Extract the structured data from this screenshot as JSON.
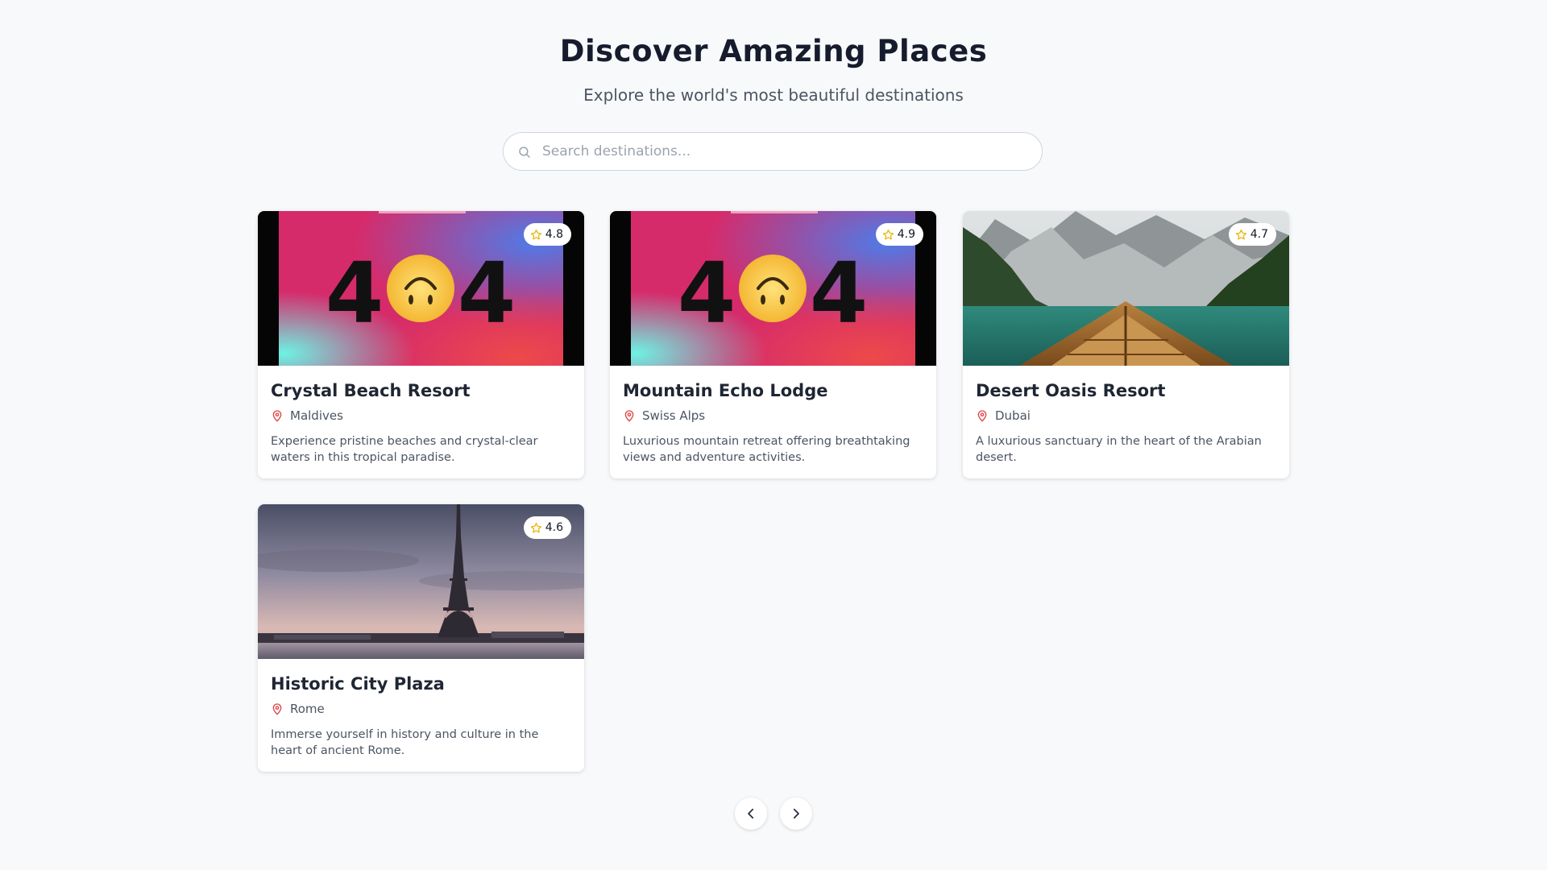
{
  "header": {
    "title": "Discover Amazing Places",
    "subtitle": "Explore the world's most beautiful destinations"
  },
  "search": {
    "placeholder": "Search destinations...",
    "value": "",
    "icon": "search-icon"
  },
  "colors": {
    "background": "#f8f9fb",
    "pin": "#e04444",
    "star": "#eab308",
    "title": "#161c2d"
  },
  "destinations": [
    {
      "name": "Crystal Beach Resort",
      "location": "Maldives",
      "description": "Experience pristine beaches and crystal-clear waters in this tropical paradise.",
      "rating": "4.8",
      "image": "404 error placeholder image with upside-down smiley face"
    },
    {
      "name": "Mountain Echo Lodge",
      "location": "Swiss Alps",
      "description": "Luxurious mountain retreat offering breathtaking views and adventure activities.",
      "rating": "4.9",
      "image": "404 error placeholder image with upside-down smiley face"
    },
    {
      "name": "Desert Oasis Resort",
      "location": "Dubai",
      "description": "A luxurious sanctuary in the heart of the Arabian desert.",
      "rating": "4.7",
      "image": "wooden boat bow on a green mountain lake"
    },
    {
      "name": "Historic City Plaza",
      "location": "Rome",
      "description": "Immerse yourself in history and culture in the heart of ancient Rome.",
      "rating": "4.6",
      "image": "Eiffel Tower at dusk over the river"
    }
  ],
  "pagination": {
    "prev_icon": "chevron-left-icon",
    "next_icon": "chevron-right-icon"
  }
}
